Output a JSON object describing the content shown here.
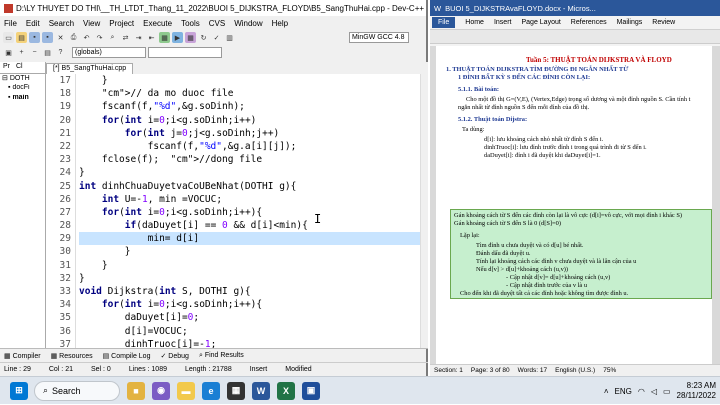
{
  "devcpp": {
    "title": "D:\\LY THUYET DO THI\\__TH_LTDT_Thang_11_2022\\BUOI 5_DIJKSTRA_FLOYD\\B5_SangThuHai.cpp - Dev-C++ 5.6.3",
    "menu": [
      "File",
      "Edit",
      "Search",
      "View",
      "Project",
      "Execute",
      "Tools",
      "CVS",
      "Window",
      "Help"
    ],
    "globals_combo": "(globals)",
    "compiler_combo": "MinGW GCC 4.8",
    "project_tabs": [
      "Pr",
      "Cl"
    ],
    "tree": [
      "DOTH",
      "docFi",
      "main"
    ],
    "file_tab": "[*] B5_SangThuHai.cpp",
    "line_numbers": [
      "17",
      "18",
      "19",
      "20",
      "21",
      "22",
      "23",
      "24",
      "25",
      "26",
      "27",
      "28",
      "29",
      "30",
      "31",
      "32",
      "33",
      "34",
      "35",
      "36",
      "37",
      "38",
      "39",
      "40"
    ],
    "bottom_tabs": [
      "Compiler",
      "Resources",
      "Compile Log",
      "Debug",
      "Find Results"
    ],
    "status": {
      "line": "Line : 29",
      "col": "Col : 21",
      "sel": "Sel : 0",
      "lines": "Lines : 1089",
      "length": "Length : 21788",
      "mode": "Insert",
      "modified": "Modified"
    }
  },
  "code_lines": [
    "    }",
    "    // da mo duoc file",
    "    fscanf(f,\"%d\",&g.soDinh);",
    "    for(int i=0;i<g.soDinh;i++)",
    "        for(int j=0;j<g.soDinh;j++)",
    "            fscanf(f,\"%d\",&g.a[i][j]);",
    "    fclose(f);  //dong file",
    "}",
    "int dinhChuaDuyetvaCoUBeNhat(DOTHI g){",
    "    int U=-1, min =VOCUC;",
    "    for(int i=0;i<g.soDinh;i++){",
    "        if(daDuyet[i] == 0 && d[i]<min){",
    "            min= d[i]",
    "        }",
    "    }",
    "}",
    "void Dijkstra(int S, DOTHI g){",
    "    for(int i=0;i<g.soDinh;i++){",
    "        daDuyet[i]=0;",
    "        d[i]=VOCUC;",
    "        dinhTruoc[i]=-1;",
    "    }",
    "    int U;",
    "    d[S]=0;",
    "    for(int i=0;i<g.soDinh;i++){"
  ],
  "word": {
    "title": "BUOI 5_DIJKSTRAvaFLOYD.docx - Micros...",
    "tabs": [
      "File",
      "Home",
      "Insert",
      "Page Layout",
      "References",
      "Mailings",
      "Review"
    ],
    "heading": "Tuần 5: THUẬT TOÁN DIJKSTRA VÀ FLOYD",
    "h1": "1. THUẬT TOÁN DIJKSTRA TÌM ĐƯỜNG ĐI NGẮN NHẤT TỪ",
    "h1b": "1 ĐỈNH BẤT KỲ S ĐẾN CÁC ĐỈNH CÒN LẠI:",
    "s511": "5.1.1. Bài toán:",
    "p1": "Cho một đồ thị G=(V,E), (Vertex,Edge) trọng số dương và một đỉnh nguồn S. Cần tính t",
    "p1b": "ngắn nhất từ đỉnh nguồn S đến mỗi đỉnh của đồ thị.",
    "s512": "5.1.2. Thuật toán Dijstra:",
    "tadung": "Ta dùng:",
    "d": "d[i]: lưu khoảng cách nhỏ nhất từ đỉnh S đến i.",
    "dt": "dinhTruoc[i]: lưu đỉnh trước đỉnh i trong quá trình đi từ S đến i.",
    "dd": "daDuyet[i]: đỉnh i đã duyệt khi daDuyet[i]=1.",
    "g1": "Gán khoảng cách từ S đến các đỉnh còn lại là vô cực (d[i]=vô cực, với mọi đỉnh i khác S)",
    "g2": "Gán khoảng cách từ S đến S là 0 (d[S]=0)",
    "lap": "Lặp lại:",
    "l1": "Tìm đỉnh u chưa duyệt và có d[u] bé nhất.",
    "l2": "Đánh dấu đã duyệt u.",
    "l3": "Tính lại khoảng cách các đỉnh v chưa duyệt và là lân cận của u",
    "l4": "Nếu d[v] > d[u]+khoảng cách (u,v))",
    "l5": "- Cập nhật d[v]= d[u]+khoảng cách (u,v)",
    "l6": "- Cập nhật đỉnh trước của v là u",
    "l7": "Cho đến khi đã duyệt tất cả các đỉnh hoặc không tìm được đỉnh u.",
    "status_section": "Section: 1",
    "status_page": "Page: 3 of 80",
    "status_words": "Words: 17",
    "status_lang": "English (U.S.)",
    "zoom": "75%"
  },
  "taskbar": {
    "search": "Search",
    "lang": "ENG",
    "time": "8:23 AM",
    "date": "28/11/2022"
  }
}
